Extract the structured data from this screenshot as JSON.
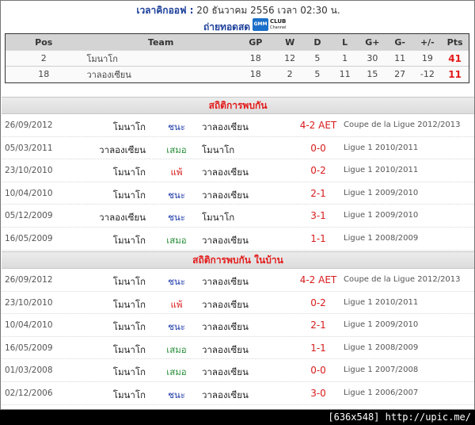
{
  "header": {
    "kickoff_label": "เวลาคิกออฟ :",
    "kickoff_value": "20 ธันวาคม 2556 เวลา 02:30 น.",
    "live_label": "ถ่ายทอดสด :",
    "channel_logo": {
      "left": "GMM",
      "right": "CLUB",
      "sub": "Channel"
    }
  },
  "standings": {
    "headers": [
      "Pos",
      "Team",
      "GP",
      "W",
      "D",
      "L",
      "G+",
      "G-",
      "+/-",
      "Pts"
    ],
    "rows": [
      {
        "pos": "2",
        "team": "โมนาโก",
        "gp": "18",
        "w": "12",
        "d": "5",
        "l": "1",
        "gf": "30",
        "ga": "11",
        "gd": "19",
        "pts": "41"
      },
      {
        "pos": "18",
        "team": "วาลองเซียน",
        "gp": "18",
        "w": "2",
        "d": "5",
        "l": "11",
        "gf": "15",
        "ga": "27",
        "gd": "-12",
        "pts": "11"
      }
    ]
  },
  "h2h": {
    "title": "สถิติการพบกัน",
    "matches": [
      {
        "date": "26/09/2012",
        "home": "โมนาโก",
        "result": "ชนะ",
        "away": "วาลองเซียน",
        "score": "4-2 AET",
        "comp": "Coupe de la Ligue 2012/2013"
      },
      {
        "date": "05/03/2011",
        "home": "วาลองเซียน",
        "result": "เสมอ",
        "away": "โมนาโก",
        "score": "0-0",
        "comp": "Ligue 1 2010/2011"
      },
      {
        "date": "23/10/2010",
        "home": "โมนาโก",
        "result": "แพ้",
        "away": "วาลองเซียน",
        "score": "0-2",
        "comp": "Ligue 1 2010/2011"
      },
      {
        "date": "10/04/2010",
        "home": "โมนาโก",
        "result": "ชนะ",
        "away": "วาลองเซียน",
        "score": "2-1",
        "comp": "Ligue 1 2009/2010"
      },
      {
        "date": "05/12/2009",
        "home": "วาลองเซียน",
        "result": "ชนะ",
        "away": "โมนาโก",
        "score": "3-1",
        "comp": "Ligue 1 2009/2010"
      },
      {
        "date": "16/05/2009",
        "home": "โมนาโก",
        "result": "เสมอ",
        "away": "วาลองเซียน",
        "score": "1-1",
        "comp": "Ligue 1 2008/2009"
      }
    ]
  },
  "h2h_home": {
    "title": "สถิติการพบกัน ในบ้าน",
    "matches": [
      {
        "date": "26/09/2012",
        "home": "โมนาโก",
        "result": "ชนะ",
        "away": "วาลองเซียน",
        "score": "4-2 AET",
        "comp": "Coupe de la Ligue 2012/2013"
      },
      {
        "date": "23/10/2010",
        "home": "โมนาโก",
        "result": "แพ้",
        "away": "วาลองเซียน",
        "score": "0-2",
        "comp": "Ligue 1 2010/2011"
      },
      {
        "date": "10/04/2010",
        "home": "โมนาโก",
        "result": "ชนะ",
        "away": "วาลองเซียน",
        "score": "2-1",
        "comp": "Ligue 1 2009/2010"
      },
      {
        "date": "16/05/2009",
        "home": "โมนาโก",
        "result": "เสมอ",
        "away": "วาลองเซียน",
        "score": "1-1",
        "comp": "Ligue 1 2008/2009"
      },
      {
        "date": "01/03/2008",
        "home": "โมนาโก",
        "result": "เสมอ",
        "away": "วาลองเซียน",
        "score": "0-0",
        "comp": "Ligue 1 2007/2008"
      },
      {
        "date": "02/12/2006",
        "home": "โมนาโก",
        "result": "ชนะ",
        "away": "วาลองเซียน",
        "score": "3-0",
        "comp": "Ligue 1 2006/2007"
      }
    ]
  },
  "colors": {
    "win": "#1d3aa8",
    "draw": "#2a8f3b",
    "loss": "#d81b1b",
    "section_title": "#e31b1b",
    "label_blue": "#1c3f9a"
  },
  "footer": "[636x548] http://upic.me/"
}
